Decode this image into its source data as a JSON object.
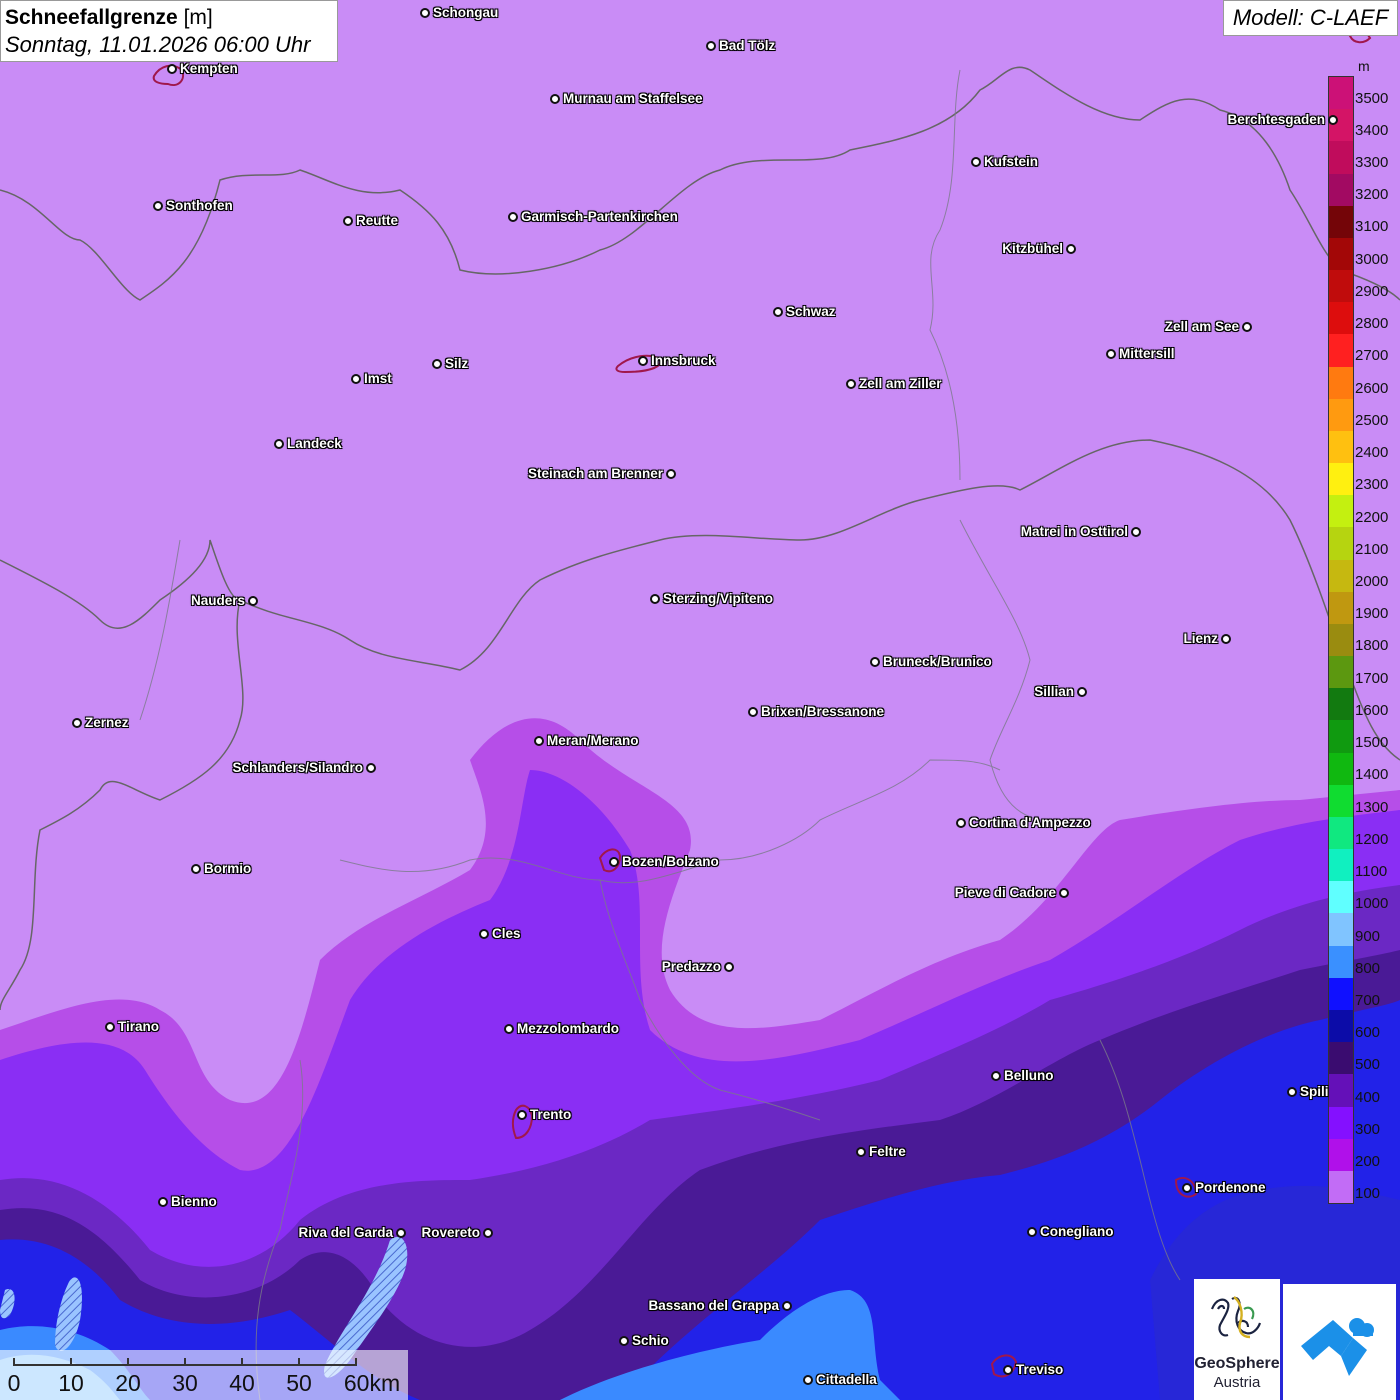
{
  "title": {
    "main": "Schneefallgrenze",
    "unit": "[m]",
    "datetime": "Sonntag, 11.01.2026 06:00 Uhr"
  },
  "model": "Modell: C-LAEF",
  "legend": {
    "unit": "m",
    "ticks": [
      "3500",
      "3400",
      "3300",
      "3200",
      "3100",
      "3000",
      "2900",
      "2800",
      "2700",
      "2600",
      "2500",
      "2400",
      "2300",
      "2200",
      "2100",
      "2000",
      "1900",
      "1800",
      "1700",
      "1600",
      "1500",
      "1400",
      "1300",
      "1200",
      "1100",
      "1000",
      "900",
      "800",
      "700",
      "600",
      "500",
      "400",
      "300",
      "200",
      "100"
    ],
    "colors": [
      "#cc1177",
      "#d41466",
      "#c00c5c",
      "#a20a62",
      "#740508",
      "#a30707",
      "#c00c0c",
      "#dd0d0d",
      "#ff2020",
      "#ff7a10",
      "#ff9a10",
      "#ffc010",
      "#fff010",
      "#c4f010",
      "#b6d410",
      "#c6b810",
      "#c09810",
      "#9a8c10",
      "#5c9810",
      "#127a10",
      "#109a10",
      "#10b810",
      "#10dc30",
      "#10e880",
      "#10f0c0",
      "#60ffff",
      "#80c4ff",
      "#3a90ff",
      "#1010ff",
      "#0c0ca8",
      "#3a0c70",
      "#6410b8",
      "#8410ff",
      "#b010ea",
      "#c26cf6"
    ]
  },
  "cities": [
    {
      "name": "Schongau",
      "side": "r"
    },
    {
      "name": "Bad Tölz",
      "side": "r"
    },
    {
      "name": "Kempten",
      "side": "r"
    },
    {
      "name": "Murnau am Staffelsee",
      "side": "r"
    },
    {
      "name": "Berchtesgaden",
      "side": "l"
    },
    {
      "name": "Kufstein",
      "side": "r"
    },
    {
      "name": "Sonthofen",
      "side": "r"
    },
    {
      "name": "Reutte",
      "side": "r"
    },
    {
      "name": "Garmisch-Partenkirchen",
      "side": "r"
    },
    {
      "name": "Kitzbühel",
      "side": "l"
    },
    {
      "name": "Schwaz",
      "side": "r"
    },
    {
      "name": "Zell am See",
      "side": "l"
    },
    {
      "name": "Mittersill",
      "side": "r"
    },
    {
      "name": "Innsbruck",
      "side": "r"
    },
    {
      "name": "Silz",
      "side": "r"
    },
    {
      "name": "Imst",
      "side": "r"
    },
    {
      "name": "Zell am Ziller",
      "side": "r"
    },
    {
      "name": "Landeck",
      "side": "r"
    },
    {
      "name": "Steinach am Brenner",
      "side": "l"
    },
    {
      "name": "Matrei in Osttirol",
      "side": "l"
    },
    {
      "name": "Nauders",
      "side": "l"
    },
    {
      "name": "Sterzing/Vipiteno",
      "side": "r"
    },
    {
      "name": "Lienz",
      "side": "l"
    },
    {
      "name": "Bruneck/Brunico",
      "side": "r"
    },
    {
      "name": "Sillian",
      "side": "l"
    },
    {
      "name": "Brixen/Bressanone",
      "side": "r"
    },
    {
      "name": "Zernez",
      "side": "r"
    },
    {
      "name": "Meran/Merano",
      "side": "r"
    },
    {
      "name": "Schlanders/Silandro",
      "side": "l"
    },
    {
      "name": "Cortina d'Ampezzo",
      "side": "r"
    },
    {
      "name": "Bozen/Bolzano",
      "side": "r"
    },
    {
      "name": "Bormio",
      "side": "r"
    },
    {
      "name": "Pieve di Cadore",
      "side": "l"
    },
    {
      "name": "Cles",
      "side": "r"
    },
    {
      "name": "Predazzo",
      "side": "l"
    },
    {
      "name": "Tirano",
      "side": "r"
    },
    {
      "name": "Mezzolombardo",
      "side": "r"
    },
    {
      "name": "Belluno",
      "side": "r"
    },
    {
      "name": "Spili",
      "side": "r"
    },
    {
      "name": "Trento",
      "side": "r"
    },
    {
      "name": "Feltre",
      "side": "r"
    },
    {
      "name": "Pordenone",
      "side": "r"
    },
    {
      "name": "Bienno",
      "side": "r"
    },
    {
      "name": "Riva del Garda",
      "side": "l"
    },
    {
      "name": "Rovereto",
      "side": "l"
    },
    {
      "name": "Conegliano",
      "side": "r"
    },
    {
      "name": "Bassano del Grappa",
      "side": "l"
    },
    {
      "name": "Schio",
      "side": "r"
    },
    {
      "name": "Treviso",
      "side": "r"
    },
    {
      "name": "Cittadella",
      "side": "r"
    }
  ],
  "scale": {
    "ticks": [
      "0",
      "10",
      "20",
      "30",
      "40",
      "50",
      "60km"
    ]
  },
  "logo": {
    "name": "GeoSphere",
    "country": "Austria"
  }
}
